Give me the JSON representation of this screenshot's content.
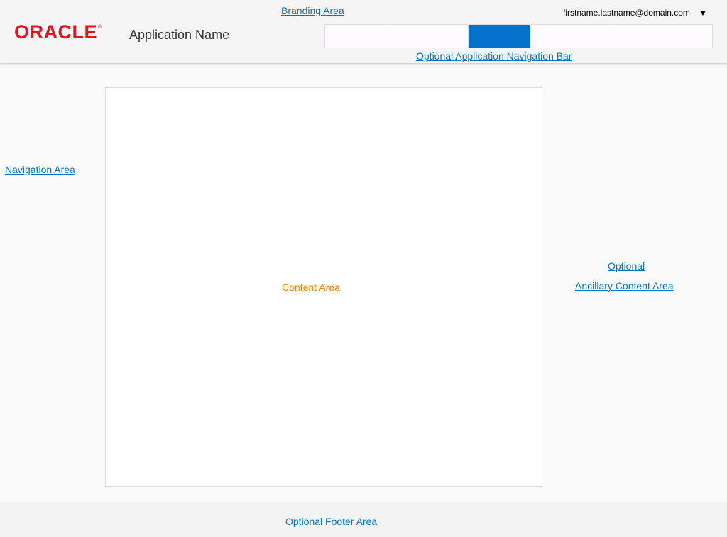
{
  "header": {
    "branding_label": "Branding Area",
    "logo_text": "ORACLE",
    "logo_mark": "®",
    "app_name": "Application Name",
    "user_email": "firstname.lastname@domain.com",
    "user_menu_icon": "caret-down-icon",
    "nav_tabs": [
      {
        "label": "",
        "selected": false
      },
      {
        "label": "",
        "selected": false
      },
      {
        "label": "",
        "selected": true
      },
      {
        "label": "",
        "selected": false
      },
      {
        "label": "",
        "selected": false
      }
    ],
    "navbar_label": "Optional Application Navigation Bar"
  },
  "navigation": {
    "label": "Navigation Area"
  },
  "content": {
    "label": "Content Area"
  },
  "ancillary": {
    "line1": "Optional",
    "line2": "Ancillary Content Area"
  },
  "footer": {
    "label": "Optional Footer Area"
  },
  "colors": {
    "brand_red": "#e8101a",
    "link_blue": "#0572ce",
    "selected_tab": "#0572ce",
    "content_label": "#f0830a"
  }
}
